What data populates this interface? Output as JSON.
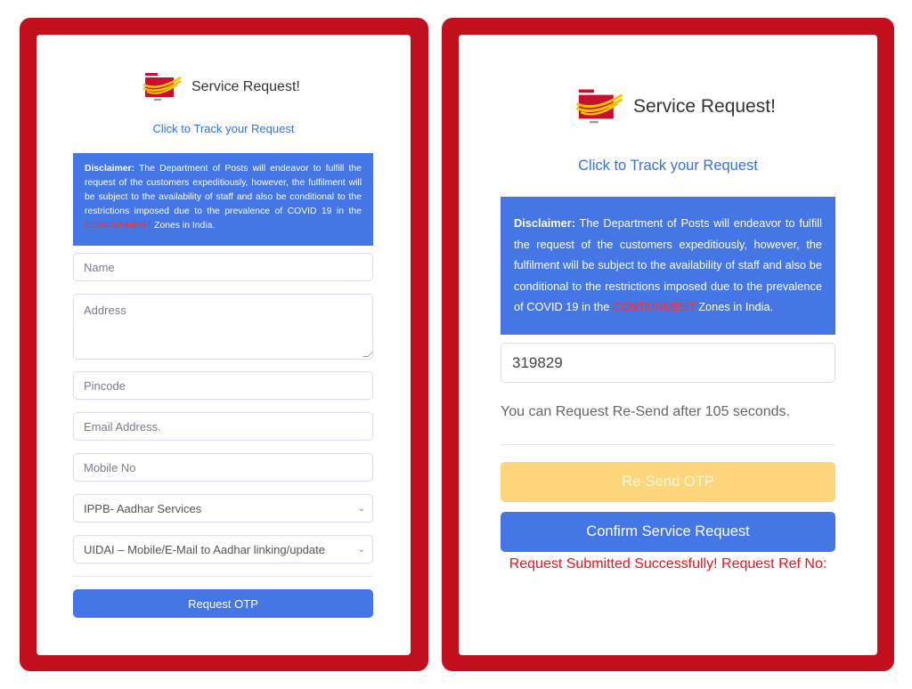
{
  "colors": {
    "frame_red": "#c10f1e",
    "primary_blue": "#4576e6",
    "link_blue": "#3b6fd6",
    "warning_yellow": "#fdd57a",
    "error_red": "#e8141d",
    "highlight_red": "#ff2d2d"
  },
  "left_panel": {
    "title": "Service Request!",
    "logo": "india-post-logo",
    "track_link": "Click to Track your Request",
    "disclaimer": {
      "label": "Disclaimer:",
      "text_before": " The Department of Posts will endeavor to fulfill the request of the customers expeditiously, however, the fulfilment will be subject to the availability of staff and also be conditional to the restrictions imposed due to the prevalence of COVID 19 in the ",
      "highlight": "CONTAINMENT",
      "text_after": " Zones in India."
    },
    "fields": {
      "name_placeholder": "Name",
      "address_placeholder": "Address",
      "pincode_placeholder": "Pincode",
      "email_placeholder": "Email Address.",
      "mobile_placeholder": "Mobile No",
      "service_select_value": "IPPB- Aadhar Services",
      "subservice_select_value": "UIDAI – Mobile/E-Mail to Aadhar linking/update"
    },
    "request_otp_button": "Request OTP"
  },
  "right_panel": {
    "title": "Service Request!",
    "logo": "india-post-logo",
    "track_link": "Click to Track your Request",
    "disclaimer": {
      "label": "Disclaimer:",
      "text_before": " The Department of Posts will endeavor to fulfill the request of the customers expeditiously, however, the fulfilment will be subject to the availability of staff and also be conditional to the restrictions imposed due to the prevalence of COVID 19 in the ",
      "highlight": "CONTAINMENT",
      "text_after": " Zones in India."
    },
    "otp_value": "319829",
    "resend_note": "You can Request Re-Send after 105 seconds.",
    "resend_button": "Re-Send OTP",
    "confirm_button": "Confirm Service Request",
    "success_message": "Request Submitted Successfully! Request Ref No:"
  }
}
